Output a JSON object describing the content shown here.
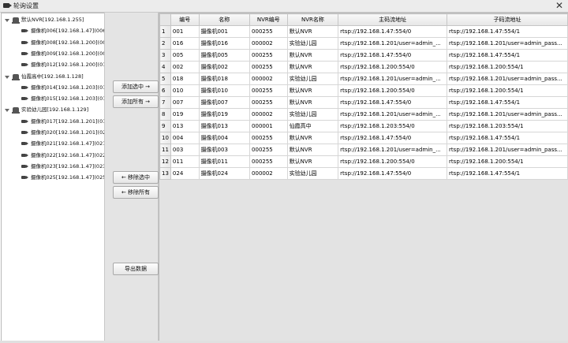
{
  "window": {
    "title": "轮询设置",
    "close_glyph": "✕"
  },
  "tree": [
    {
      "label": "默认NVR[192.168.1.255]",
      "children": [
        "摄像机006[192.168.1.47](006)",
        "摄像机008[192.168.1.200](008)",
        "摄像机009[192.168.1.200](009)",
        "摄像机012[192.168.1.200](012)"
      ]
    },
    {
      "label": "仙霞高中[192.168.1.128]",
      "children": [
        "摄像机014[192.168.1.203](014)",
        "摄像机015[192.168.1.203](015)"
      ]
    },
    {
      "label": "实验幼儿园[192.168.1.129]",
      "children": [
        "摄像机017[192.168.1.201](017)",
        "摄像机020[192.168.1.201](020)",
        "摄像机021[192.168.1.47](021)",
        "摄像机022[192.168.1.47](022)",
        "摄像机023[192.168.1.47](023)",
        "摄像机025[192.168.1.47](025)"
      ]
    }
  ],
  "buttons": {
    "add_selected": "添加选中 →",
    "add_all": "添加所有 →",
    "remove_selected": "← 移除选中",
    "remove_all": "← 移除所有",
    "export": "导出数据"
  },
  "table": {
    "columns": [
      "编号",
      "名称",
      "NVR编号",
      "NVR名称",
      "主码流地址",
      "子码流地址"
    ],
    "rows": [
      [
        "1",
        "001",
        "摄像机001",
        "000255",
        "默认NVR",
        "rtsp://192.168.1.47:554/0",
        "rtsp://192.168.1.47:554/1"
      ],
      [
        "2",
        "016",
        "摄像机016",
        "000002",
        "实验幼儿园",
        "rtsp://192.168.1.201/user=admin_...",
        "rtsp://192.168.1.201/user=admin_pass..."
      ],
      [
        "3",
        "005",
        "摄像机005",
        "000255",
        "默认NVR",
        "rtsp://192.168.1.47:554/0",
        "rtsp://192.168.1.47:554/1"
      ],
      [
        "4",
        "002",
        "摄像机002",
        "000255",
        "默认NVR",
        "rtsp://192.168.1.200:554/0",
        "rtsp://192.168.1.200:554/1"
      ],
      [
        "5",
        "018",
        "摄像机018",
        "000002",
        "实验幼儿园",
        "rtsp://192.168.1.201/user=admin_...",
        "rtsp://192.168.1.201/user=admin_pass..."
      ],
      [
        "6",
        "010",
        "摄像机010",
        "000255",
        "默认NVR",
        "rtsp://192.168.1.200:554/0",
        "rtsp://192.168.1.200:554/1"
      ],
      [
        "7",
        "007",
        "摄像机007",
        "000255",
        "默认NVR",
        "rtsp://192.168.1.47:554/0",
        "rtsp://192.168.1.47:554/1"
      ],
      [
        "8",
        "019",
        "摄像机019",
        "000002",
        "实验幼儿园",
        "rtsp://192.168.1.201/user=admin_...",
        "rtsp://192.168.1.201/user=admin_pass..."
      ],
      [
        "9",
        "013",
        "摄像机013",
        "000001",
        "仙霞高中",
        "rtsp://192.168.1.203:554/0",
        "rtsp://192.168.1.203:554/1"
      ],
      [
        "10",
        "004",
        "摄像机004",
        "000255",
        "默认NVR",
        "rtsp://192.168.1.47:554/0",
        "rtsp://192.168.1.47:554/1"
      ],
      [
        "11",
        "003",
        "摄像机003",
        "000255",
        "默认NVR",
        "rtsp://192.168.1.201/user=admin_...",
        "rtsp://192.168.1.201/user=admin_pass..."
      ],
      [
        "12",
        "011",
        "摄像机011",
        "000255",
        "默认NVR",
        "rtsp://192.168.1.200:554/0",
        "rtsp://192.168.1.200:554/1"
      ],
      [
        "13",
        "024",
        "摄像机024",
        "000002",
        "实验幼儿园",
        "rtsp://192.168.1.47:554/0",
        "rtsp://192.168.1.47:554/1"
      ]
    ]
  }
}
